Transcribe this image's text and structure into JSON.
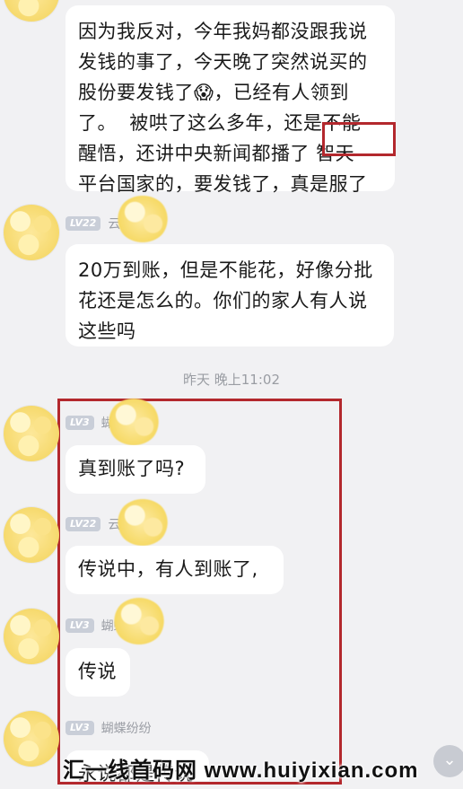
{
  "messages": [
    {
      "text": "因为我反对，今年我妈都没跟我说\n发钱的事了，今天晚了突然说买的\n股份要发钱了😱，已经有人领到\n了。  被哄了这么多年，还是不能\n醒悟，还讲中央新闻都播了 智天\n平台国家的，要发钱了，真是服了"
    },
    {
      "level": "LV22",
      "nick": "云",
      "text": "20万到账，但是不能花，好像分批\n花还是怎么的。你们的家人有人说\n这些吗"
    },
    {
      "level": "LV3",
      "nick": "蝴",
      "text": "真到账了吗?"
    },
    {
      "level": "LV22",
      "nick": "云",
      "text": "传说中，有人到账了,"
    },
    {
      "level": "LV3",
      "nick": "蝴蝶",
      "text": "传说"
    },
    {
      "level": "LV3",
      "nick": "蝴蝶纷纷",
      "text": "永说都是传说"
    }
  ],
  "timestamp": "昨天 晚上11:02",
  "highlight_word": "智天",
  "watermark": "汇一线首码网 www.huiyixian.com",
  "colors": {
    "background": "#f1f1f3",
    "bubble": "#ffffff",
    "annotation_red": "#b3282d",
    "badge": "#c9ced8"
  },
  "icons": {
    "scroll": "chevron-down-icon"
  }
}
